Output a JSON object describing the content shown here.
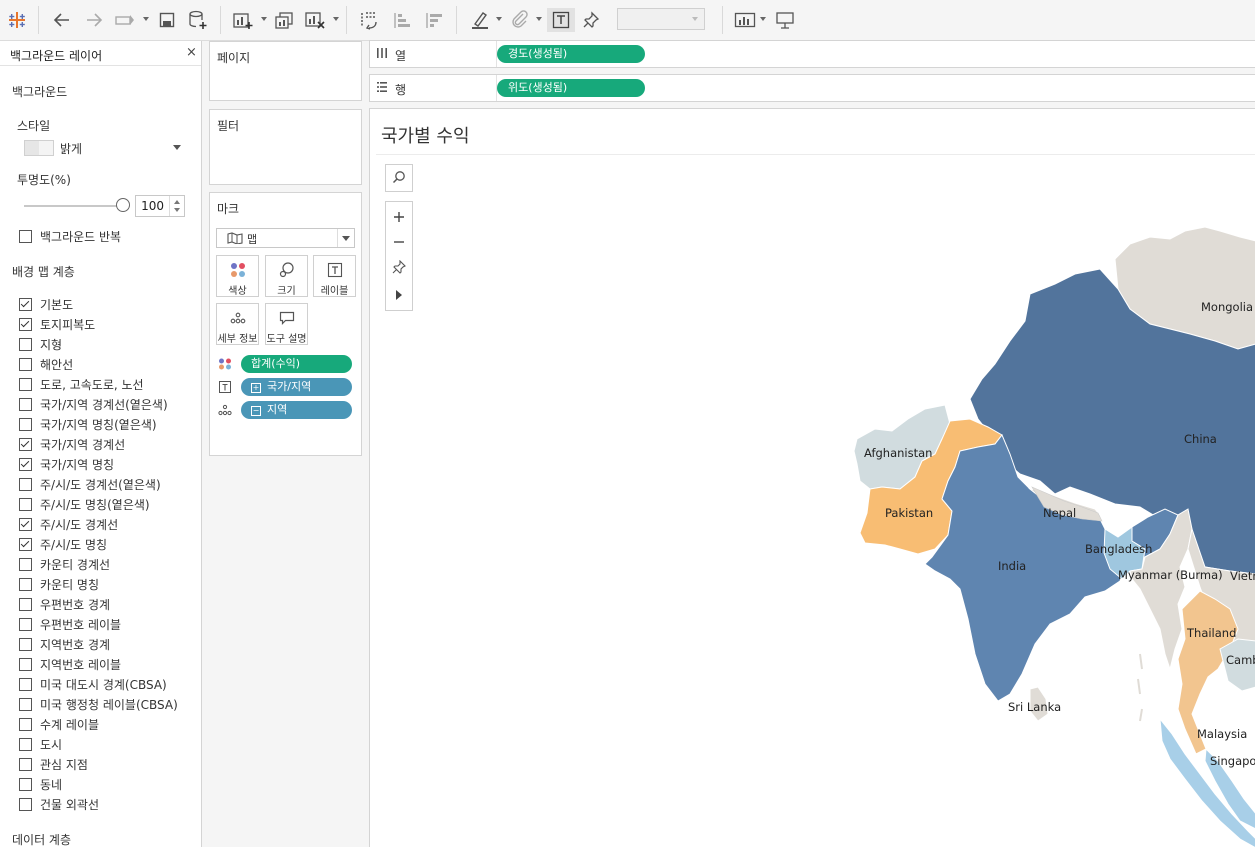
{
  "toolbar": {
    "icons": [
      "tableau-logo-icon",
      "undo-icon",
      "redo-icon",
      "replay-icon",
      "save-icon",
      "new-datasource-icon",
      "new-worksheet-icon",
      "duplicate-sheet-icon",
      "clear-sheet-icon",
      "swap-rows-columns-icon",
      "sort-ascending-icon",
      "sort-descending-icon",
      "highlight-icon",
      "group-members-icon",
      "show-mark-labels-icon",
      "fix-axes-icon",
      "show-me-icon",
      "presentation-mode-icon"
    ],
    "fit_select_value": ""
  },
  "left_pane": {
    "title": "백그라운드 레이어",
    "close": "×",
    "background_section": "백그라운드",
    "style_label": "스타일",
    "style_value": "밝게",
    "opacity_label": "투명도(%)",
    "opacity_value": "100",
    "opacity_fraction": 1.0,
    "repeat_background_label": "백그라운드 반복",
    "repeat_background_checked": false,
    "layers_section": "배경 맵 계층",
    "layers": [
      {
        "label": "기본도",
        "checked": true
      },
      {
        "label": "토지피복도",
        "checked": true
      },
      {
        "label": "지형",
        "checked": false
      },
      {
        "label": "해안선",
        "checked": false
      },
      {
        "label": "도로, 고속도로, 노선",
        "checked": false
      },
      {
        "label": "국가/지역 경계선(옅은색)",
        "checked": false
      },
      {
        "label": "국가/지역 명칭(옅은색)",
        "checked": false
      },
      {
        "label": "국가/지역 경계선",
        "checked": true
      },
      {
        "label": "국가/지역 명칭",
        "checked": true
      },
      {
        "label": "주/시/도 경계선(옅은색)",
        "checked": false
      },
      {
        "label": "주/시/도 명칭(옅은색)",
        "checked": false
      },
      {
        "label": "주/시/도 경계선",
        "checked": true
      },
      {
        "label": "주/시/도 명칭",
        "checked": true
      },
      {
        "label": "카운티 경계선",
        "checked": false
      },
      {
        "label": "카운티 명칭",
        "checked": false
      },
      {
        "label": "우편번호 경계",
        "checked": false
      },
      {
        "label": "우편번호 레이블",
        "checked": false
      },
      {
        "label": "지역번호 경계",
        "checked": false
      },
      {
        "label": "지역번호 레이블",
        "checked": false
      },
      {
        "label": "미국 대도시 경계(CBSA)",
        "checked": false
      },
      {
        "label": "미국 행정청 레이블(CBSA)",
        "checked": false
      },
      {
        "label": "수계 레이블",
        "checked": false
      },
      {
        "label": "도시",
        "checked": false
      },
      {
        "label": "관심 지점",
        "checked": false
      },
      {
        "label": "동네",
        "checked": false
      },
      {
        "label": "건물 외곽선",
        "checked": false
      }
    ],
    "data_layers_section": "데이터 계층"
  },
  "cards": {
    "pages": "페이지",
    "filters": "필터",
    "marks": {
      "title": "마크",
      "type": "맵",
      "buttons": [
        {
          "label": "색상",
          "icon": "color-icon"
        },
        {
          "label": "크기",
          "icon": "size-icon"
        },
        {
          "label": "레이블",
          "icon": "label-icon"
        },
        {
          "label": "세부 정보",
          "icon": "detail-icon"
        },
        {
          "label": "도구 설명",
          "icon": "tooltip-icon"
        }
      ],
      "pills": [
        {
          "label": "합계(수익)",
          "icon": "color-icon",
          "prefix": "",
          "color": "#17a97b"
        },
        {
          "label": "국가/지역",
          "icon": "label-icon",
          "prefix": "+",
          "color": "#4a96b7"
        },
        {
          "label": "지역",
          "icon": "detail-icon",
          "prefix": "−",
          "color": "#4a96b7"
        }
      ]
    }
  },
  "shelves": {
    "columns": {
      "label": "열",
      "icon": "columns-icon",
      "pill": "경도(생성됨)"
    },
    "rows": {
      "label": "행",
      "icon": "rows-icon",
      "pill": "위도(생성됨)"
    }
  },
  "view": {
    "title": "국가별 수익",
    "map_tools": [
      "search-icon",
      "zoom-in-icon",
      "zoom-out-icon",
      "pin-icon",
      "expand-icon"
    ],
    "countries": [
      "Mongolia",
      "China",
      "Afghanistan",
      "Pakistan",
      "Nepal",
      "India",
      "Bangladesh",
      "Myanmar (Burma)",
      "Vietnam",
      "Thailand",
      "Cambodia",
      "Sri Lanka",
      "Malaysia",
      "Singapore"
    ]
  },
  "colors": {
    "accent_green": "#17a97b",
    "pill_blue": "#4a96b7",
    "china": "#52749c",
    "india": "#5f85b0",
    "pakistan": "#f8bd73",
    "thailand": "#f2c58f",
    "afghanistan": "#d1dcdf",
    "bangladesh": "#9fc7df",
    "mongolia": "#e0dcd6",
    "malaysia": "#a8cfe8"
  }
}
